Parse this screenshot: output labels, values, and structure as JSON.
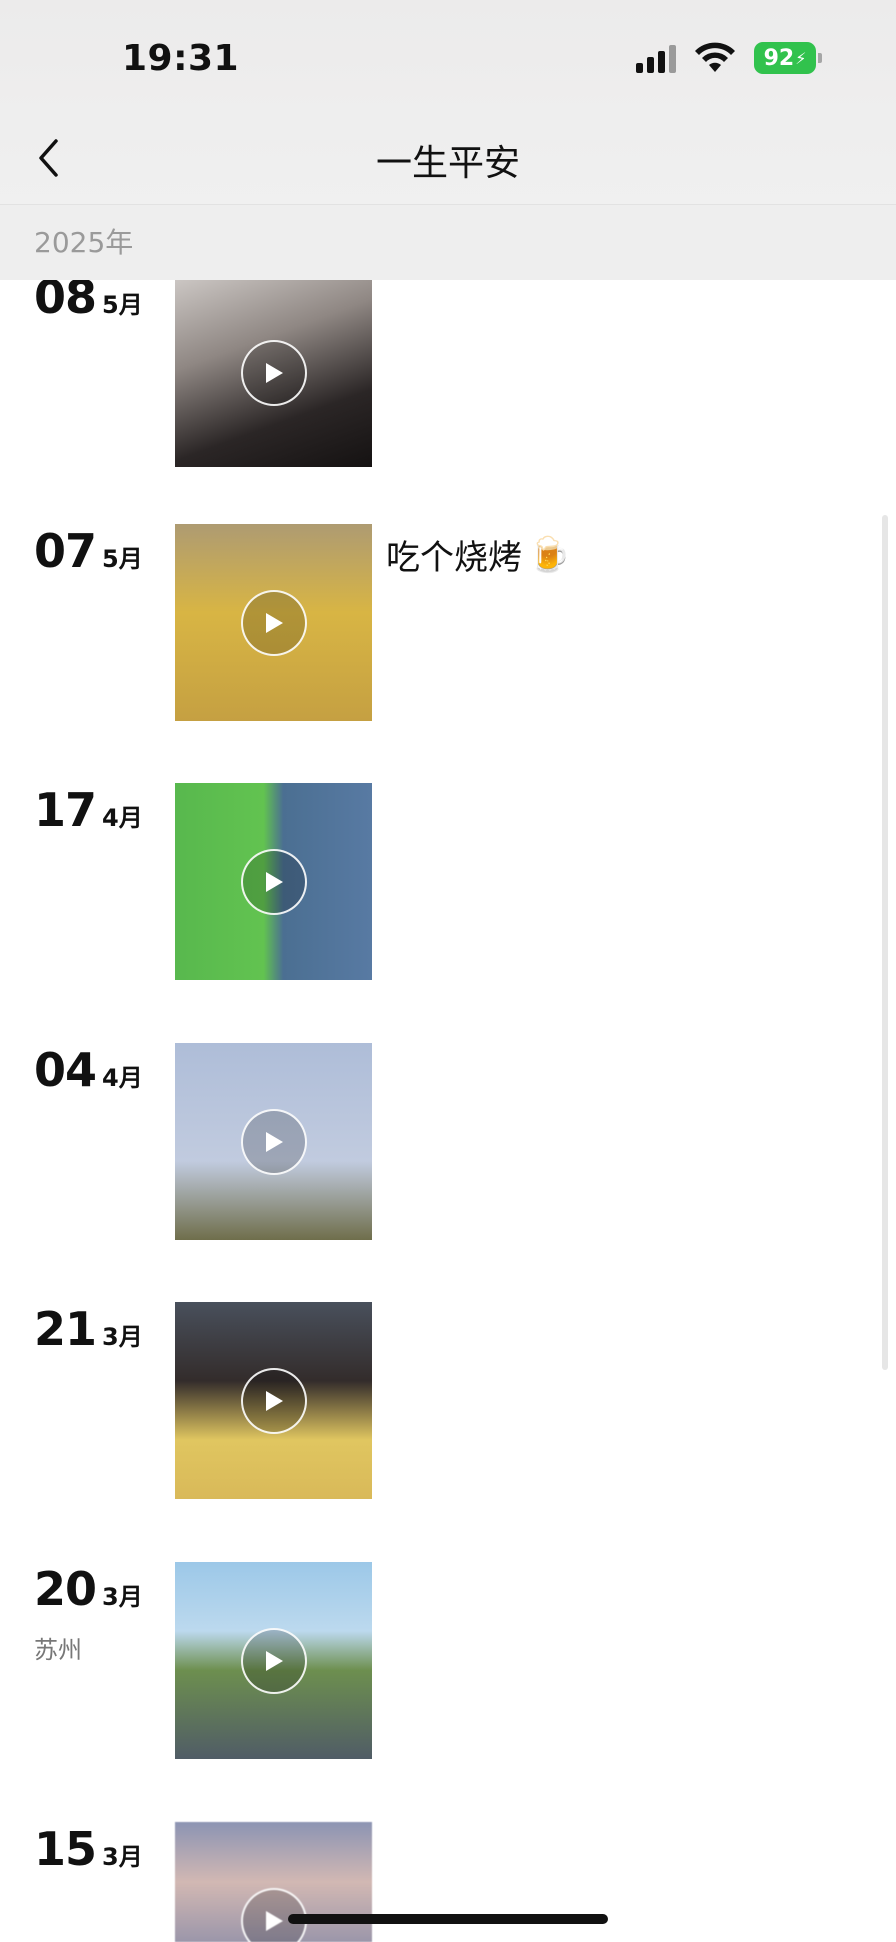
{
  "status_bar": {
    "time": "19:31",
    "battery": "92"
  },
  "nav": {
    "title": "一生平安",
    "back_icon": "chevron-left-icon"
  },
  "section": {
    "year": "2025年"
  },
  "entries": [
    {
      "day": "08",
      "month": "5月",
      "location": "",
      "caption": "",
      "thumb_icon": "play-icon"
    },
    {
      "day": "07",
      "month": "5月",
      "location": "",
      "caption": "吃个烧烤",
      "caption_emoji": "🍺",
      "thumb_icon": "play-icon"
    },
    {
      "day": "17",
      "month": "4月",
      "location": "",
      "caption": "",
      "thumb_icon": "play-icon"
    },
    {
      "day": "04",
      "month": "4月",
      "location": "",
      "caption": "",
      "thumb_icon": "play-icon"
    },
    {
      "day": "21",
      "month": "3月",
      "location": "",
      "caption": "",
      "thumb_icon": "play-icon"
    },
    {
      "day": "20",
      "month": "3月",
      "location": "苏州",
      "caption": "",
      "thumb_icon": "play-icon"
    },
    {
      "day": "15",
      "month": "3月",
      "location": "",
      "caption": "",
      "thumb_icon": "play-icon"
    }
  ],
  "colors": {
    "battery": "#31c24d",
    "header_bg": "#eeeeee",
    "year_text": "#9a9a9a"
  }
}
